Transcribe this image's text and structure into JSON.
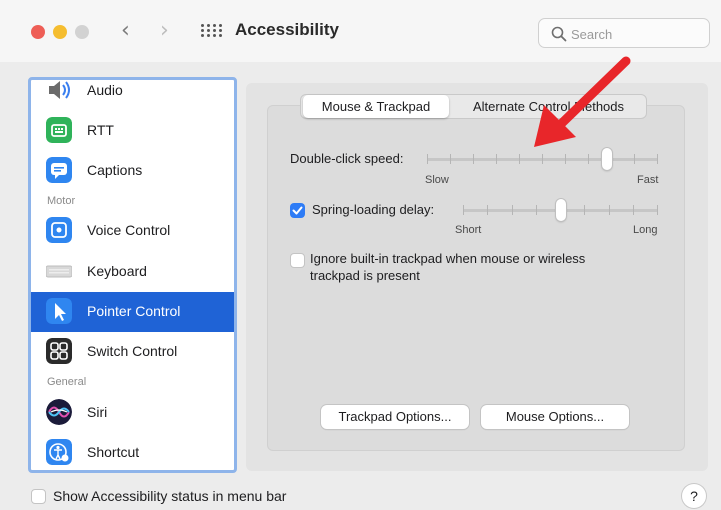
{
  "window": {
    "title": "Accessibility",
    "search_placeholder": "Search"
  },
  "sidebar": {
    "items": [
      {
        "label": "Audio",
        "icon": "speaker-icon"
      },
      {
        "label": "RTT",
        "icon": "rtt-icon"
      },
      {
        "label": "Captions",
        "icon": "captions-icon"
      },
      {
        "label": "Voice Control",
        "icon": "voice-control-icon"
      },
      {
        "label": "Keyboard",
        "icon": "keyboard-icon"
      },
      {
        "label": "Pointer Control",
        "icon": "pointer-icon"
      },
      {
        "label": "Switch Control",
        "icon": "switch-control-icon"
      },
      {
        "label": "Siri",
        "icon": "siri-icon"
      },
      {
        "label": "Shortcut",
        "icon": "shortcut-icon"
      }
    ],
    "headers": {
      "motor": "Motor",
      "general": "General"
    },
    "selected": "Pointer Control"
  },
  "main": {
    "tabs": [
      {
        "label": "Mouse & Trackpad",
        "active": true
      },
      {
        "label": "Alternate Control Methods",
        "active": false
      }
    ],
    "double_click": {
      "label": "Double-click speed:",
      "min_label": "Slow",
      "max_label": "Fast",
      "value_fraction": 0.78
    },
    "spring_loading": {
      "label": "Spring-loading delay:",
      "checked": true,
      "min_label": "Short",
      "max_label": "Long",
      "value_fraction": 0.5
    },
    "ignore_trackpad": {
      "label_line1": "Ignore built-in trackpad when mouse or wireless",
      "label_line2": "trackpad is present",
      "checked": false
    },
    "buttons": {
      "trackpad_options": "Trackpad Options...",
      "mouse_options": "Mouse Options..."
    }
  },
  "footer": {
    "status_checkbox_label": "Show Accessibility status in menu bar",
    "help_label": "?"
  },
  "colors": {
    "accent": "#2e7cf6",
    "selection": "#1f63d6",
    "annotation_arrow": "#e8262a"
  }
}
